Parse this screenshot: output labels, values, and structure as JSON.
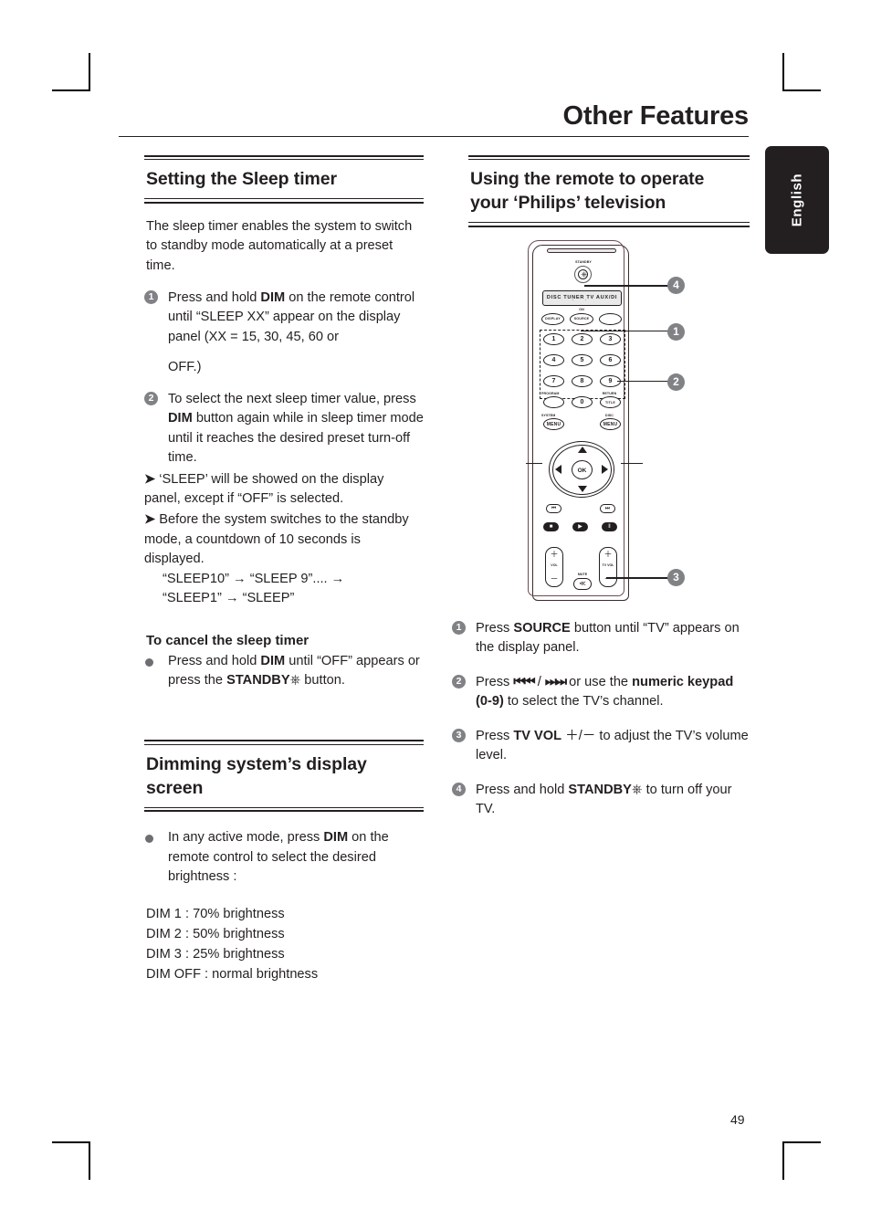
{
  "page": {
    "title": "Other Features",
    "language_tab": "English",
    "page_number": "49"
  },
  "left_column": {
    "section1": {
      "heading": "Setting the Sleep timer",
      "intro": "The sleep timer enables the system to switch to standby mode automatically at a preset time.",
      "steps": [
        {
          "num": "1",
          "line1_a": "Press and hold ",
          "line1_b": "DIM",
          "line1_c": " on the remote control until “SLEEP XX” appear on the display panel (XX = 15, 30, 45, 60 or",
          "line2": "OFF.)"
        },
        {
          "num": "2",
          "line1_a": "To select the next sleep timer value, press ",
          "line1_b": "DIM",
          "line1_c": " button again while in sleep timer mode until it reaches the desired preset turn-off time.",
          "note1": "‘SLEEP’ will be showed on the display panel, except if “OFF” is selected.",
          "note2": "Before the system switches to the standby mode, a countdown of 10 seconds is displayed.",
          "seq1": "“SLEEP10” → “SLEEP 9”.... →",
          "seq2": "“SLEEP1” → “SLEEP”"
        }
      ],
      "cancel_heading": "To cancel the sleep timer",
      "cancel_bullet_a": "Press and hold ",
      "cancel_bullet_b": "DIM",
      "cancel_bullet_c": " until “OFF” appears or press the ",
      "cancel_bullet_d": "STANDBY",
      "cancel_bullet_e": " button."
    },
    "section2": {
      "heading": "Dimming system’s display screen",
      "bullet_a": "In any active mode, press ",
      "bullet_b": "DIM",
      "bullet_c": " on the remote control to select the desired brightness :",
      "dim_levels": [
        "DIM 1 : 70% brightness",
        "DIM 2 : 50% brightness",
        "DIM 3 : 25% brightness",
        "DIM OFF : normal brightness"
      ]
    }
  },
  "right_column": {
    "heading_line1": "Using the remote to operate",
    "heading_line2": "your ‘Philips’ television",
    "steps": [
      {
        "num": "1",
        "a": "Press ",
        "b": "SOURCE",
        "c": " button until “TV” appears on the display panel."
      },
      {
        "num": "2",
        "a": "Press ",
        "b": "⏮⏮",
        "c": " / ",
        "d": "⏭⏭",
        "e": " or use the ",
        "f": "numeric keypad (0-9)",
        "g": " to select the TV’s channel."
      },
      {
        "num": "3",
        "a": "Press ",
        "b": "TV VOL",
        "c": " ＋/－ ",
        "d": " to adjust the TV’s volume level."
      },
      {
        "num": "4",
        "a": "Press and hold ",
        "b": "STANDBY",
        "c": " to turn off your TV."
      }
    ]
  },
  "remote": {
    "standby_label": "STANDBY",
    "source_bar": "DISC TUNER TV AUX/DI",
    "source_bar_dots": "· ·",
    "on_label": "ON",
    "display_button": "DISPLAY",
    "source_button": "SOURCE",
    "keypad": [
      "1",
      "2",
      "3",
      "4",
      "5",
      "6",
      "7",
      "8",
      "9",
      "0"
    ],
    "program_label": "PROGRAM",
    "return_label": "RETURN",
    "title_button": "TITLE",
    "system_label": "SYSTEM",
    "system_button": "MENU",
    "disc_label": "DISC",
    "disc_button": "MENU",
    "ok_button": "OK",
    "prev_button": "⏮",
    "next_button": "⏭",
    "stop_button": "■",
    "play_button": "▶",
    "pause_button": "‖",
    "vol_label": "VOL",
    "tv_vol_label": "TV VOL",
    "mute_label": "MUTE",
    "mute_icon": "≪",
    "plus": "＋",
    "minus": "－",
    "callouts": [
      "1",
      "2",
      "3",
      "4"
    ]
  }
}
